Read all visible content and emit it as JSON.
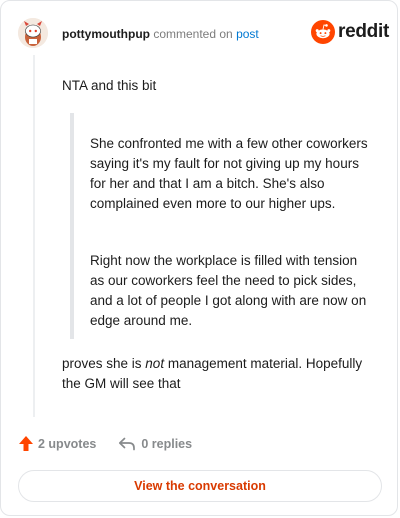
{
  "header": {
    "username": "pottymouthpup",
    "action": "commented on",
    "post_link": "post",
    "logo_text": "reddit"
  },
  "comment": {
    "intro": "NTA and this bit",
    "quote_paragraphs": [
      "She confronted me with a few other coworkers saying it's my fault for not giving up my hours for her and that I am a bitch. She's also complained even more to our higher ups.",
      "Right now the workplace is filled with tension as our coworkers feel the need to pick sides, and a lot of people I got along with are now on edge around me."
    ],
    "conclusion_before": "proves she is ",
    "conclusion_emphasis": "not",
    "conclusion_after": " management material. Hopefully the GM will see that"
  },
  "footer": {
    "upvotes": "2 upvotes",
    "replies": "0 replies",
    "view_button": "View the conversation"
  },
  "icons": {
    "avatar": "snoo-avatar-icon",
    "logo": "reddit-snoo-icon",
    "upvote": "upvote-arrow-icon",
    "reply": "reply-arrow-icon"
  },
  "colors": {
    "brand": "#ff4500",
    "link": "#0079d3",
    "button_text": "#d93a00",
    "muted": "#878a8c"
  }
}
